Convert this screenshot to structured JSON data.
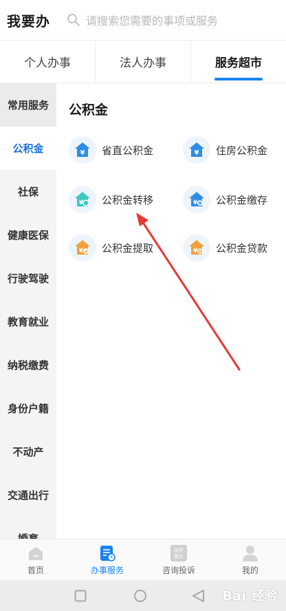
{
  "header": {
    "title": "我要办",
    "search_placeholder": "请搜索您需要的事项或服务"
  },
  "tabs": [
    {
      "label": "个人办事",
      "active": false
    },
    {
      "label": "法人办事",
      "active": false
    },
    {
      "label": "服务超市",
      "active": true
    }
  ],
  "sidebar": {
    "items": [
      {
        "label": "常用服务"
      },
      {
        "label": "公积金"
      },
      {
        "label": "社保"
      },
      {
        "label": "健康医保"
      },
      {
        "label": "行驶驾驶"
      },
      {
        "label": "教育就业"
      },
      {
        "label": "纳税缴费"
      },
      {
        "label": "身份户籍"
      },
      {
        "label": "不动产"
      },
      {
        "label": "交通出行"
      },
      {
        "label": "婚育"
      }
    ],
    "active_index": 1
  },
  "main": {
    "section_title": "公积金",
    "services": [
      {
        "label": "省直公积金",
        "icon": "house-yuan-icon"
      },
      {
        "label": "住房公积金",
        "icon": "house-yuan-icon"
      },
      {
        "label": "公积金转移",
        "icon": "house-transfer-icon"
      },
      {
        "label": "公积金缴存",
        "icon": "house-deposit-icon"
      },
      {
        "label": "公积金提取",
        "icon": "house-withdraw-icon"
      },
      {
        "label": "公积金贷款",
        "icon": "house-loan-icon"
      }
    ]
  },
  "bottom_nav": [
    {
      "label": "首页",
      "icon": "home-icon"
    },
    {
      "label": "办事服务",
      "icon": "service-icon",
      "active": true
    },
    {
      "label": "咨询投诉",
      "icon": "consult-icon"
    },
    {
      "label": "我的",
      "icon": "profile-icon"
    }
  ],
  "consult_icon_text": [
    "民呼",
    "我为"
  ],
  "watermark": "Bai 经验",
  "colors": {
    "accent": "#1a82f0",
    "blue_icon": "#2f8de4",
    "orange_icon": "#f0a03c",
    "teal_icon": "#3cc7c0",
    "arrow": "#e53935"
  }
}
